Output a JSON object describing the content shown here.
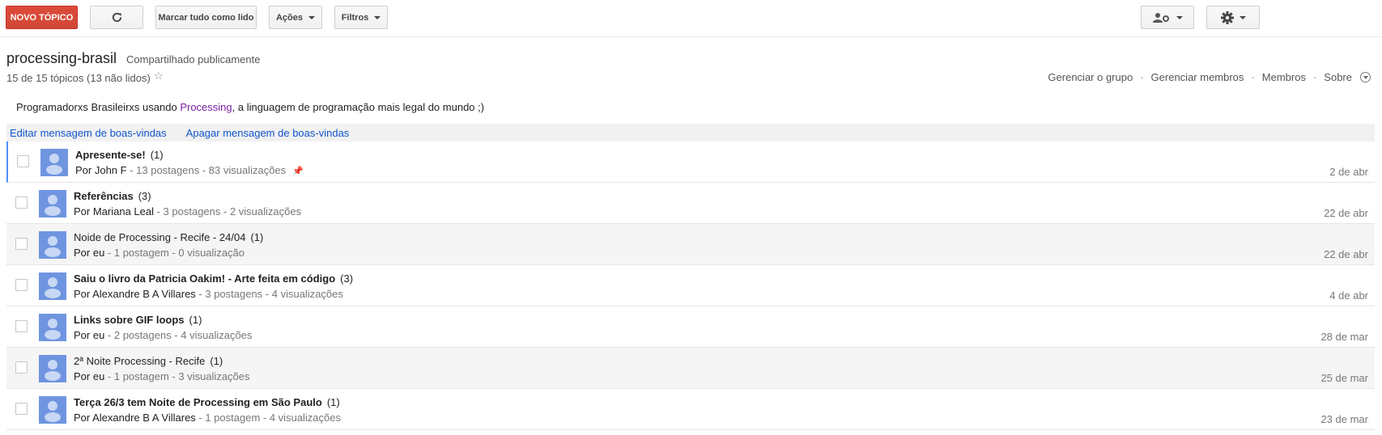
{
  "toolbar": {
    "new_topic": "NOVO TÓPICO",
    "mark_all_read": "Marcar tudo como lido",
    "actions": "Ações",
    "filters": "Filtros"
  },
  "group": {
    "name": "processing-brasil",
    "share_status": "Compartilhado publicamente",
    "topic_count": "15 de 15 tópicos (13 não lidos)",
    "links": {
      "manage_group": "Gerenciar o grupo",
      "manage_members": "Gerenciar membros",
      "members": "Membros",
      "about": "Sobre"
    }
  },
  "welcome": {
    "before": "Programadorxs Brasileirxs usando ",
    "link": "Processing",
    "after": ", a linguagem de programação mais legal do mundo ;)",
    "edit": "Editar mensagem de boas-vindas",
    "delete": "Apagar mensagem de boas-vindas"
  },
  "topics": [
    {
      "title": "Apresente-se!",
      "count": "(1)",
      "author": "Por John F",
      "stats": " - 13 postagens - 83 visualizações",
      "date": "2 de abr"
    },
    {
      "title": "Referências",
      "count": "(3)",
      "author": "Por Mariana Leal",
      "stats": " - 3 postagens - 2 visualizações",
      "date": "22 de abr"
    },
    {
      "title": "Noide de Processing - Recife - 24/04",
      "count": "(1)",
      "author": "Por eu",
      "stats": " - 1 postagem - 0 visualização",
      "date": "22 de abr"
    },
    {
      "title": "Saiu o livro da Patricia Oakim! - Arte feita em código",
      "count": "(3)",
      "author": "Por Alexandre B A Villares",
      "stats": " - 3 postagens - 4 visualizações",
      "date": "4 de abr"
    },
    {
      "title": "Links sobre GIF loops",
      "count": "(1)",
      "author": "Por eu",
      "stats": " - 2 postagens - 4 visualizações",
      "date": "28 de mar"
    },
    {
      "title": "2ª Noite Processing - Recife",
      "count": "(1)",
      "author": "Por eu",
      "stats": " - 1 postagem - 3 visualizações",
      "date": "25 de mar"
    },
    {
      "title": "Terça 26/3 tem Noite de Processing em São Paulo",
      "count": "(1)",
      "author": "Por Alexandre B A Villares",
      "stats": " - 1 postagem - 4 visualizações",
      "date": "23 de mar"
    }
  ]
}
